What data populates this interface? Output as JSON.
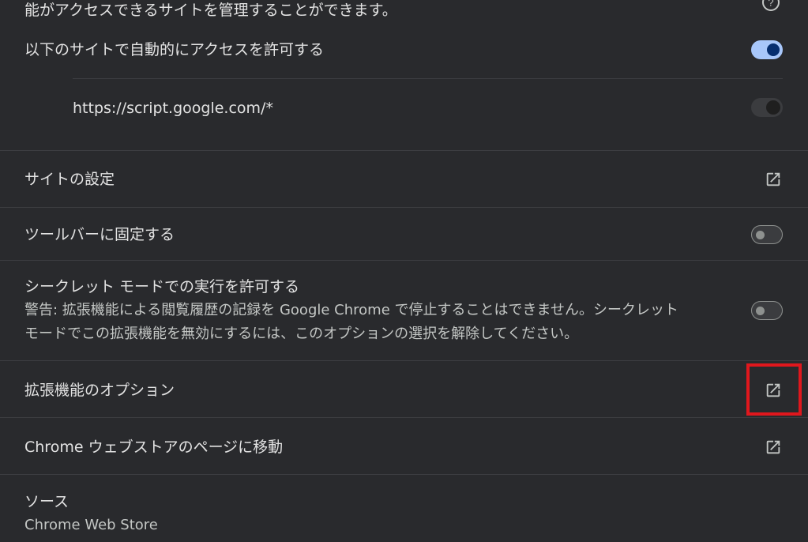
{
  "site_access": {
    "description_tail": "能がアクセスできるサイトを管理することができます。",
    "auto_allow_label": "以下のサイトで自動的にアクセスを許可する",
    "auto_allow_enabled": true,
    "sites": [
      {
        "url": "https://script.google.com/*",
        "enabled": false
      }
    ]
  },
  "rows": {
    "site_settings": {
      "label": "サイトの設定"
    },
    "pin_to_toolbar": {
      "label": "ツールバーに固定する",
      "enabled": false
    },
    "incognito": {
      "label": "シークレット モードでの実行を許可する",
      "warning_line1": "警告: 拡張機能による閲覧履歴の記録を Google Chrome で停止することはできません。シークレット",
      "warning_line2": "モードでこの拡張機能を無効にするには、このオプションの選択を解除してください。",
      "enabled": false
    },
    "extension_options": {
      "label": "拡張機能のオプション"
    },
    "web_store": {
      "label": "Chrome ウェブストアのページに移動"
    },
    "source": {
      "label": "ソース",
      "value": "Chrome Web Store"
    }
  },
  "colors": {
    "background": "#292a2d",
    "divider": "#3c3d41",
    "toggle_on": "#a8c7fa",
    "highlight": "#e0171d"
  },
  "icons": {
    "help": "help-circle-icon",
    "external_link": "open-in-new-icon"
  }
}
